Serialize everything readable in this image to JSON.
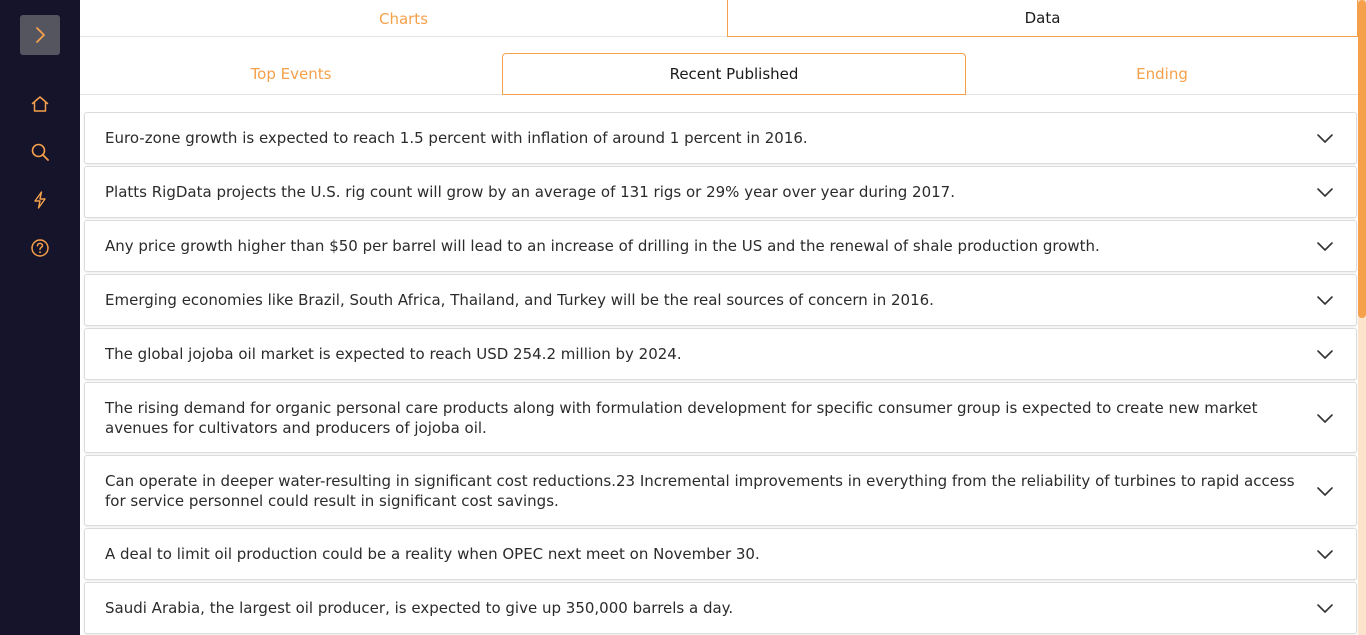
{
  "tabs": {
    "charts": "Charts",
    "data": "Data",
    "active": "Data"
  },
  "sub_tabs": {
    "top_events": "Top Events",
    "recent_published": "Recent Published",
    "ending": "Ending",
    "active": "Recent Published"
  },
  "sidebar": {
    "expand_icon": "chevron-right-icon",
    "items": [
      {
        "icon": "home-icon"
      },
      {
        "icon": "search-icon"
      },
      {
        "icon": "lightning-icon"
      },
      {
        "icon": "help-icon"
      }
    ]
  },
  "items": [
    "Euro-zone growth is expected to reach 1.5 percent with inflation of around 1 percent in 2016.",
    "Platts RigData projects the U.S. rig count will grow by an average of 131 rigs or 29% year over year during 2017.",
    "Any price growth higher than $50 per barrel will lead to an increase of drilling in the US and the renewal of shale production growth.",
    "Emerging economies like Brazil, South Africa, Thailand, and Turkey will be the real sources of concern in 2016.",
    "The global jojoba oil market is expected to reach USD 254.2 million by 2024.",
    "The rising demand for organic personal care products along with formulation development for specific consumer group is expected to create new market avenues for cultivators and producers of jojoba oil.",
    "Can operate in deeper water-resulting in significant cost reductions.23 Incremental improvements in everything from the reliability of turbines to rapid access for service personnel could result in significant cost savings.",
    "A deal to limit oil production could be a reality when OPEC next meet on November 30.",
    "Saudi Arabia, the largest oil producer, is expected to give up 350,000 barrels a day."
  ],
  "colors": {
    "accent": "#f5a04a",
    "sidebar_bg": "#15142a",
    "expand_bg": "#555560"
  }
}
